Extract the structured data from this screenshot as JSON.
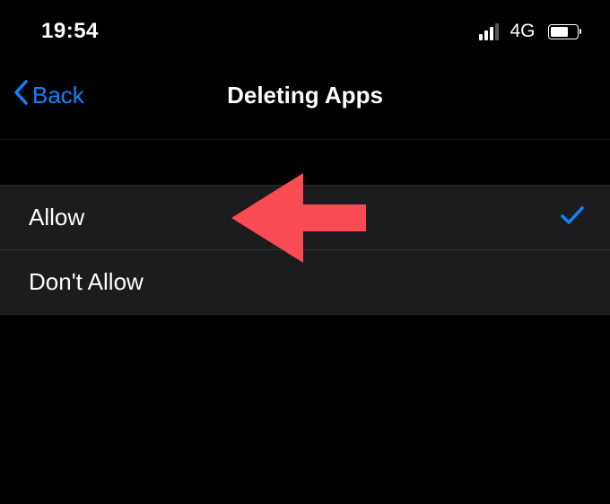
{
  "statusBar": {
    "time": "19:54",
    "networkType": "4G",
    "signalStrength": 3,
    "batteryLevel": 70
  },
  "navBar": {
    "backLabel": "Back",
    "title": "Deleting Apps"
  },
  "options": [
    {
      "label": "Allow",
      "selected": true
    },
    {
      "label": "Don't Allow",
      "selected": false
    }
  ],
  "colors": {
    "accent": "#0a84ff",
    "annotation": "#f94b54"
  }
}
